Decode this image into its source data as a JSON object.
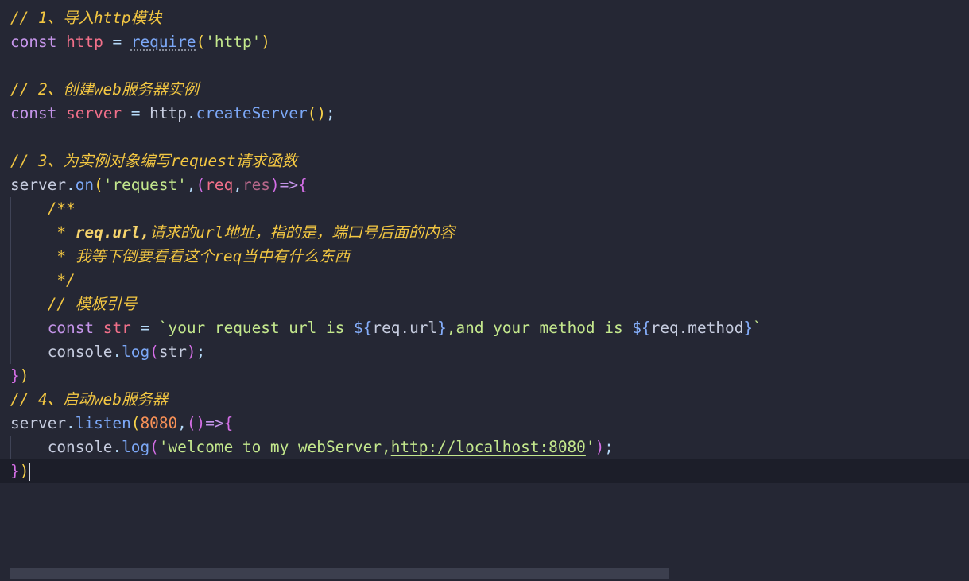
{
  "editor": {
    "lines": {
      "l1": {
        "comment": "// 1、导入http模块"
      },
      "l2": {
        "kw": "const",
        "var": "http",
        "eq": "=",
        "fn": "require",
        "popen": "(",
        "str": "'http'",
        "pclose": ")"
      },
      "l4": {
        "comment": "// 2、创建web服务器实例"
      },
      "l5": {
        "kw": "const",
        "var": "server",
        "eq": "=",
        "obj": "http",
        "dot": ".",
        "fn": "createServer",
        "parens": "()",
        "semi": ";"
      },
      "l7": {
        "comment": "// 3、为实例对象编写request请求函数"
      },
      "l8": {
        "obj": "server",
        "dot": ".",
        "fn": "on",
        "popen": "(",
        "str": "'request'",
        "comma": ",",
        "aopen": "(",
        "p1": "req",
        "comma2": ",",
        "p2": "res",
        "aclose": ")",
        "arrow": "=>",
        "bopen": "{"
      },
      "l9": {
        "text": "/**"
      },
      "l10": {
        "star": " * ",
        "tag": "req.url,",
        "text": "请求的url地址，指的是，端口号后面的内容"
      },
      "l11": {
        "text": " * 我等下倒要看看这个req当中有什么东西"
      },
      "l12": {
        "text": " */"
      },
      "l13": {
        "comment": "// 模板引号"
      },
      "l14": {
        "kw": "const",
        "var": "str",
        "eq": "=",
        "s1": "`your request url is ",
        "e1open": "${",
        "e1": "req.url",
        "e1close": "}",
        "s2": ",and your method is ",
        "e2open": "${",
        "e2": "req.method",
        "e2close": "}",
        "s3": "`"
      },
      "l15": {
        "obj": "console",
        "dot": ".",
        "fn": "log",
        "popen": "(",
        "arg": "str",
        "pclose": ")",
        "semi": ";"
      },
      "l16": {
        "bclose": "}",
        "pclose": ")"
      },
      "l17": {
        "comment": "// 4、启动web服务器"
      },
      "l18": {
        "obj": "server",
        "dot": ".",
        "fn": "listen",
        "popen": "(",
        "num": "8080",
        "comma": ",",
        "aparens": "()",
        "arrow": "=>",
        "bopen": "{"
      },
      "l19": {
        "obj": "console",
        "dot": ".",
        "fn": "log",
        "popen": "(",
        "s1": "'welcome to my webServer,",
        "link": "http://localhost:8080",
        "s2": "'",
        "pclose": ")",
        "semi": ";"
      },
      "l20": {
        "bclose": "}",
        "pclose": ")"
      }
    }
  }
}
